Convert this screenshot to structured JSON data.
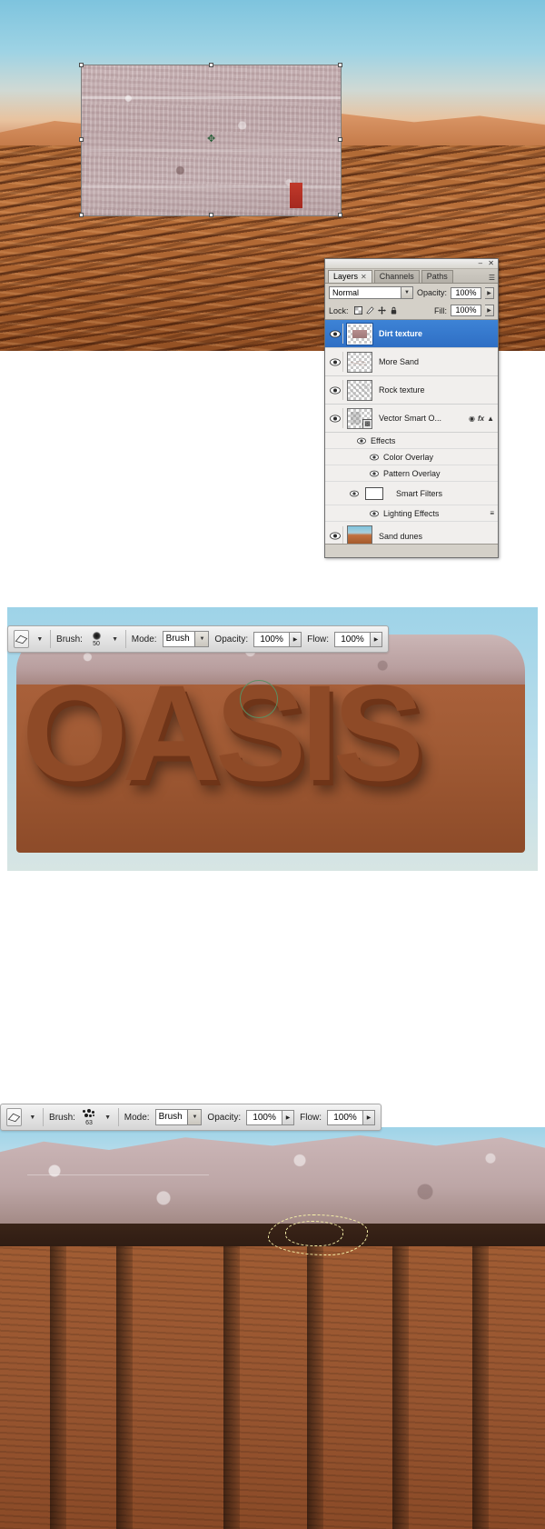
{
  "layers_panel": {
    "title_buttons": [
      "minimize",
      "close"
    ],
    "tabs": [
      {
        "label": "Layers",
        "active": true,
        "closable": true
      },
      {
        "label": "Channels",
        "active": false,
        "closable": false
      },
      {
        "label": "Paths",
        "active": false,
        "closable": false
      }
    ],
    "menu_icon": "panel-menu-icon",
    "blend_mode": "Normal",
    "opacity_label": "Opacity:",
    "opacity_value": "100%",
    "lock_label": "Lock:",
    "lock_icons": [
      "lock-transparent-pixels-icon",
      "lock-image-pixels-icon",
      "lock-position-icon",
      "lock-all-icon"
    ],
    "fill_label": "Fill:",
    "fill_value": "100%",
    "layers": [
      {
        "name": "Dirt texture",
        "selected": true,
        "visible": true,
        "thumb": "dirt"
      },
      {
        "name": "More Sand",
        "selected": false,
        "visible": true,
        "thumb": "sand"
      },
      {
        "name": "Rock texture",
        "selected": false,
        "visible": true,
        "thumb": "rock"
      },
      {
        "name": "Vector Smart O...",
        "selected": false,
        "visible": true,
        "thumb": "vso",
        "badges": [
          "smart-object-icon",
          "layer-effects-fx-icon",
          "expand-arrow-icon"
        ]
      }
    ],
    "sub_items": [
      {
        "name": "Effects",
        "indent": 1,
        "visible": true
      },
      {
        "name": "Color Overlay",
        "indent": 2,
        "visible": true
      },
      {
        "name": "Pattern Overlay",
        "indent": 2,
        "visible": true
      },
      {
        "name": "Smart Filters",
        "indent": 1,
        "visible": true,
        "swatch": true
      },
      {
        "name": "Lighting Effects",
        "indent": 2,
        "visible": true,
        "right_icon": "filter-settings-icon"
      }
    ],
    "bottom_layer": {
      "name": "Sand dunes",
      "visible": true,
      "thumb": "dune"
    }
  },
  "toolbar_top": {
    "tool_icon": "eraser-tool-icon",
    "tool_caret": "tool-preset-caret",
    "brush_label": "Brush:",
    "brush_size": "50",
    "brush_tip": "soft-round-brush-icon",
    "brush_caret": "brush-preset-caret",
    "mode_label": "Mode:",
    "mode_value": "Brush",
    "opacity_label": "Opacity:",
    "opacity_value": "100%",
    "flow_label": "Flow:",
    "flow_value": "100%"
  },
  "toolbar_bottom": {
    "tool_icon": "eraser-tool-icon",
    "tool_caret": "tool-preset-caret",
    "brush_label": "Brush:",
    "brush_size": "63",
    "brush_tip": "scatter-brush-icon",
    "brush_caret": "brush-preset-caret",
    "mode_label": "Mode:",
    "mode_value": "Brush",
    "opacity_label": "Opacity:",
    "opacity_value": "100%",
    "flow_label": "Flow:",
    "flow_value": "100%"
  },
  "canvas": {
    "artwork_text": "OASIS",
    "placed_texture_name": "dirt-texture-placement",
    "brush_cursor": "brush-cursor-circle",
    "selection": "lasso-selection-marching-ants"
  }
}
